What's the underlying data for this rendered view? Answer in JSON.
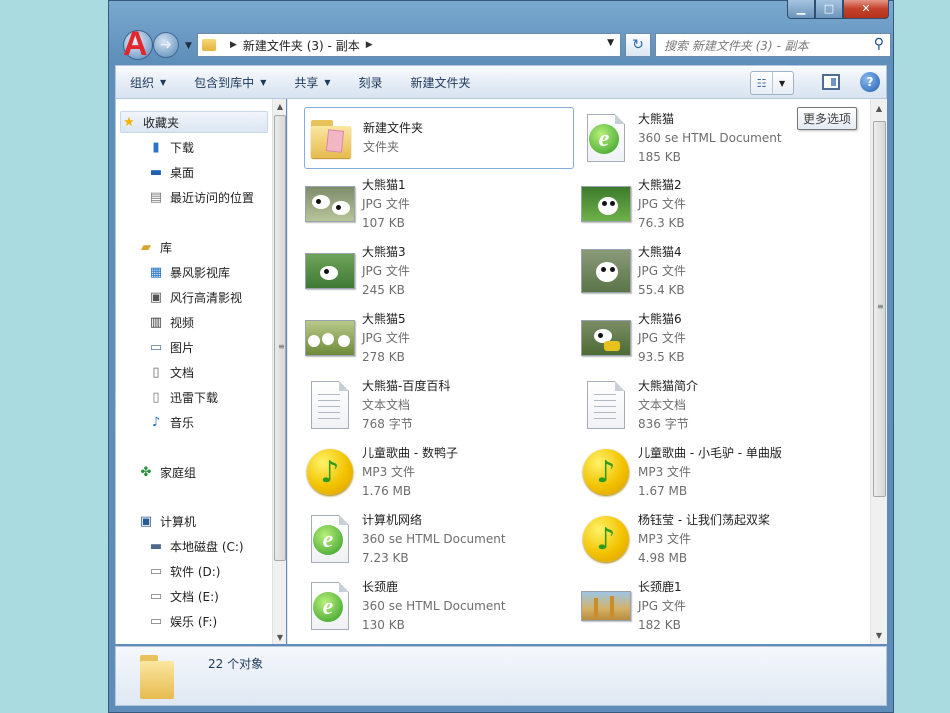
{
  "window": {
    "caption_buttons": {
      "minimize": "▁",
      "maximize": "□",
      "close": "✕"
    }
  },
  "nav": {
    "back_letter": "A",
    "path": [
      "新建文件夹 (3) - 副本"
    ],
    "search_placeholder": "搜索 新建文件夹 (3) - 副本"
  },
  "toolbar": {
    "organize": "组织",
    "include_library": "包含到库中",
    "share": "共享",
    "burn": "刻录",
    "new_folder": "新建文件夹",
    "help": "?"
  },
  "tooltip": "更多选项",
  "sidebar": {
    "favorites": {
      "title": "收藏夹",
      "items": [
        "下载",
        "桌面",
        "最近访问的位置"
      ]
    },
    "libraries": {
      "title": "库",
      "items": [
        "暴风影视库",
        "风行高清影视",
        "视频",
        "图片",
        "文档",
        "迅雷下载",
        "音乐"
      ]
    },
    "homegroup": "家庭组",
    "computer": {
      "title": "计算机",
      "items": [
        "本地磁盘 (C:)",
        "软件 (D:)",
        "文档 (E:)",
        "娱乐 (F:)"
      ]
    }
  },
  "files": [
    {
      "name": "新建文件夹",
      "type": "文件夹",
      "size": "",
      "icon": "folder-icon"
    },
    {
      "name": "大熊猫",
      "type": "360 se HTML Document",
      "size": "185 KB",
      "icon": "html-doc-icon"
    },
    {
      "name": "大熊猫1",
      "type": "JPG 文件",
      "size": "107 KB",
      "icon": "photo-icon"
    },
    {
      "name": "大熊猫2",
      "type": "JPG 文件",
      "size": "76.3 KB",
      "icon": "photo-icon"
    },
    {
      "name": "大熊猫3",
      "type": "JPG 文件",
      "size": "245 KB",
      "icon": "photo-icon"
    },
    {
      "name": "大熊猫4",
      "type": "JPG 文件",
      "size": "55.4 KB",
      "icon": "photo-icon"
    },
    {
      "name": "大熊猫5",
      "type": "JPG 文件",
      "size": "278 KB",
      "icon": "photo-icon"
    },
    {
      "name": "大熊猫6",
      "type": "JPG 文件",
      "size": "93.5 KB",
      "icon": "photo-icon"
    },
    {
      "name": "大熊猫-百度百科",
      "type": "文本文档",
      "size": "768 字节",
      "icon": "text-doc-icon"
    },
    {
      "name": "大熊猫简介",
      "type": "文本文档",
      "size": "836 字节",
      "icon": "text-doc-icon"
    },
    {
      "name": "儿童歌曲 - 数鸭子",
      "type": "MP3 文件",
      "size": "1.76 MB",
      "icon": "music-icon"
    },
    {
      "name": "儿童歌曲 - 小毛驴 - 单曲版",
      "type": "MP3 文件",
      "size": "1.67 MB",
      "icon": "music-icon"
    },
    {
      "name": "计算机网络",
      "type": "360 se HTML Document",
      "size": "7.23 KB",
      "icon": "html-doc-icon"
    },
    {
      "name": "杨钰莹 - 让我们荡起双桨",
      "type": "MP3 文件",
      "size": "4.98 MB",
      "icon": "music-icon"
    },
    {
      "name": "长颈鹿",
      "type": "360 se HTML Document",
      "size": "130 KB",
      "icon": "html-doc-icon"
    },
    {
      "name": "长颈鹿1",
      "type": "JPG 文件",
      "size": "182 KB",
      "icon": "photo-icon"
    }
  ],
  "status": {
    "count": "22 个对象"
  },
  "colors": {
    "accent": "#84acdd",
    "frame": "#5e8fba",
    "background": "#a9dbe0"
  }
}
